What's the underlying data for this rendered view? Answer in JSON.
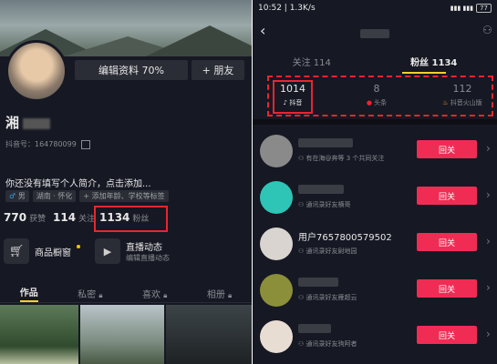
{
  "left": {
    "edit_profile_label": "编辑资料 70%",
    "add_friend_label": "+ 朋友",
    "username": "湘",
    "douyin_id": "抖音号：164780099",
    "bio": "你还没有填写个人简介，点击添加...",
    "tags": [
      "男",
      "湖南 · 怀化",
      "+ 添加年龄、学校等标签"
    ],
    "stats": [
      {
        "num": "770",
        "label": "获赞"
      },
      {
        "num": "114",
        "label": "关注"
      },
      {
        "num": "1134",
        "label": "粉丝"
      }
    ],
    "features": [
      {
        "title": "商品橱窗",
        "subtitle": ""
      },
      {
        "title": "直播动态",
        "subtitle": "编辑直播动态"
      }
    ],
    "tabs": [
      {
        "label": "作品"
      },
      {
        "label": "私密"
      },
      {
        "label": "喜欢"
      },
      {
        "label": "相册"
      }
    ]
  },
  "right": {
    "status_bar": {
      "time": "10:52 | 1.3K/s",
      "battery": "77"
    },
    "tabs": [
      {
        "label": "关注 114"
      },
      {
        "label": "粉丝 1134"
      }
    ],
    "platforms": [
      {
        "count": "1014",
        "name": "抖音"
      },
      {
        "count": "8",
        "name": "头条"
      },
      {
        "count": "112",
        "name": "抖音火山版"
      }
    ],
    "followers": [
      {
        "name": "",
        "reason": "有在海@奔等 3 个共同关注",
        "button": "回关",
        "avatar_color": "#8a8a8a"
      },
      {
        "name": "",
        "reason": "通讯录好友横哥",
        "button": "回关",
        "avatar_color": "#2ec4b6"
      },
      {
        "name": "用户7657800579502",
        "reason": "通讯录好友尉地园",
        "button": "回关",
        "avatar_color": "#d9d4cf"
      },
      {
        "name": "",
        "reason": "通讯录好友雁超云",
        "button": "回关",
        "avatar_color": "#8b8f3a"
      },
      {
        "name": "",
        "reason": "通讯录好友驹阿者",
        "button": "回关",
        "avatar_color": "#e8ddd3"
      }
    ]
  },
  "colors": {
    "accent": "#f02c55",
    "highlight_box": "#e8262f",
    "bg": "#161823"
  }
}
